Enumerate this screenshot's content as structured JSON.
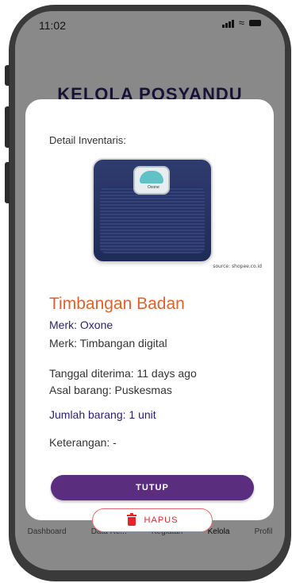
{
  "status_bar": {
    "time": "11:02"
  },
  "page": {
    "title": "KELOLA POSYANDU"
  },
  "bottom_nav": {
    "items": [
      {
        "label": "Dashboard"
      },
      {
        "label": "Data Re..."
      },
      {
        "label": "Kegiatan"
      },
      {
        "label": "Kelola"
      },
      {
        "label": "Profil"
      }
    ],
    "active": "Kelola"
  },
  "modal": {
    "heading": "Detail Inventaris:",
    "image_source": "source: shopee.co.id",
    "image_brand_mark": "Oxone",
    "item_name": "Timbangan Badan",
    "brand": "Merk: Oxone",
    "type": "Merk: Timbangan digital",
    "received_date": "Tanggal diterima: 11 days ago",
    "origin": "Asal barang: Puskesmas",
    "quantity": "Jumlah barang: 1 unit",
    "notes": "Keterangan: -",
    "close_label": "TUTUP",
    "delete_label": "HAPUS"
  },
  "colors": {
    "accent_purple": "#5b2d7e",
    "title_orange": "#e0622c",
    "delete_red": "#e0262b"
  }
}
